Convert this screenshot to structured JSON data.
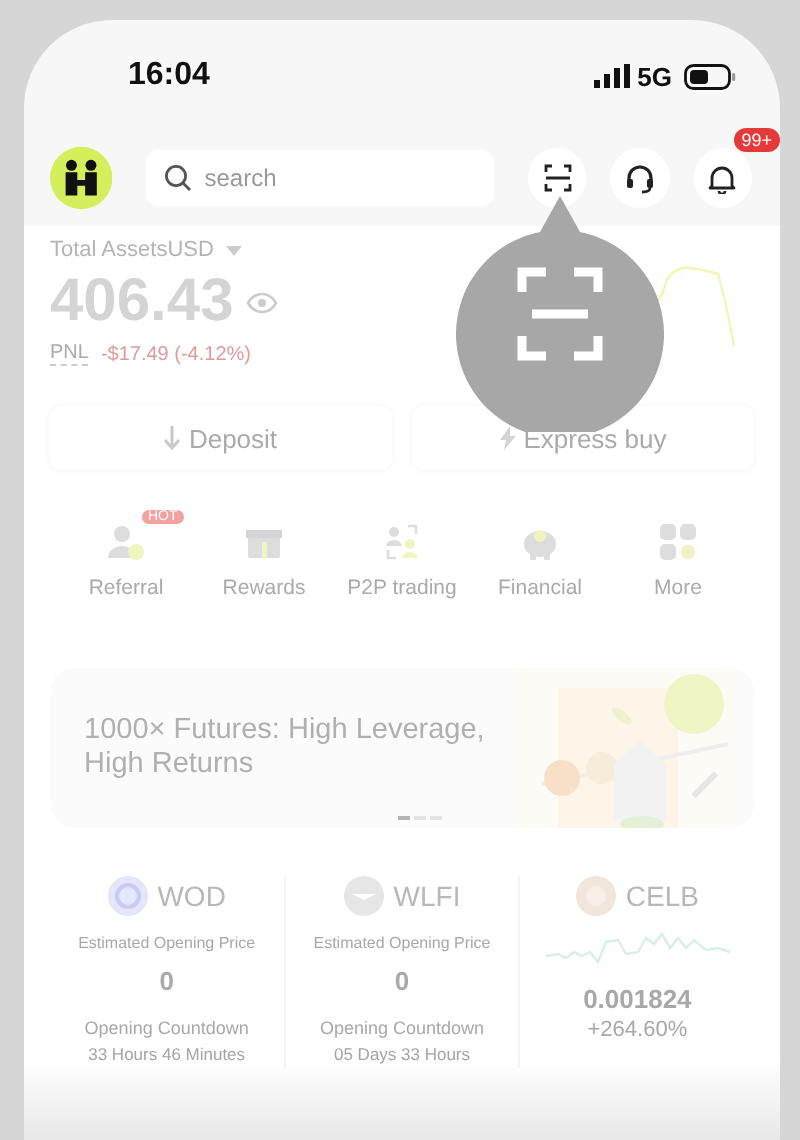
{
  "status_bar": {
    "time": "16:04",
    "network": "5G"
  },
  "header": {
    "search": {
      "placeholder": "search"
    },
    "notification_badge": "99+"
  },
  "assets": {
    "label": "Total AssetsUSD",
    "amount": "406.43",
    "pnl_label": "PNL",
    "pnl": "-$17.49 (-4.12%)"
  },
  "actions": [
    {
      "label": "Deposit",
      "kind": "deposit"
    },
    {
      "label": "Express buy",
      "kind": "express"
    }
  ],
  "shortcuts": [
    {
      "label": "Referral",
      "kind": "referral",
      "badge": "HOT"
    },
    {
      "label": "Rewards",
      "kind": "rewards"
    },
    {
      "label": "P2P trading",
      "kind": "p2p"
    },
    {
      "label": "Financial",
      "kind": "financial"
    },
    {
      "label": "More",
      "kind": "more"
    }
  ],
  "banner": {
    "title": "1000× Futures: High Leverage, High Returns",
    "pages": [
      {
        "selected": true
      },
      {
        "selected": false
      },
      {
        "selected": false
      }
    ]
  },
  "coins": [
    {
      "symbol": "WOD",
      "kind": "upcoming",
      "caption": "Estimated Opening Price",
      "price": "0",
      "countdown_label": "Opening Countdown",
      "countdown": "33 Hours 46 Minutes"
    },
    {
      "symbol": "WLFI",
      "kind": "upcoming",
      "caption": "Estimated Opening Price",
      "price": "0",
      "countdown_label": "Opening Countdown",
      "countdown": "05 Days 33 Hours"
    },
    {
      "symbol": "CELB",
      "kind": "listed",
      "price": "0.001824",
      "change": "+264.60%"
    }
  ]
}
